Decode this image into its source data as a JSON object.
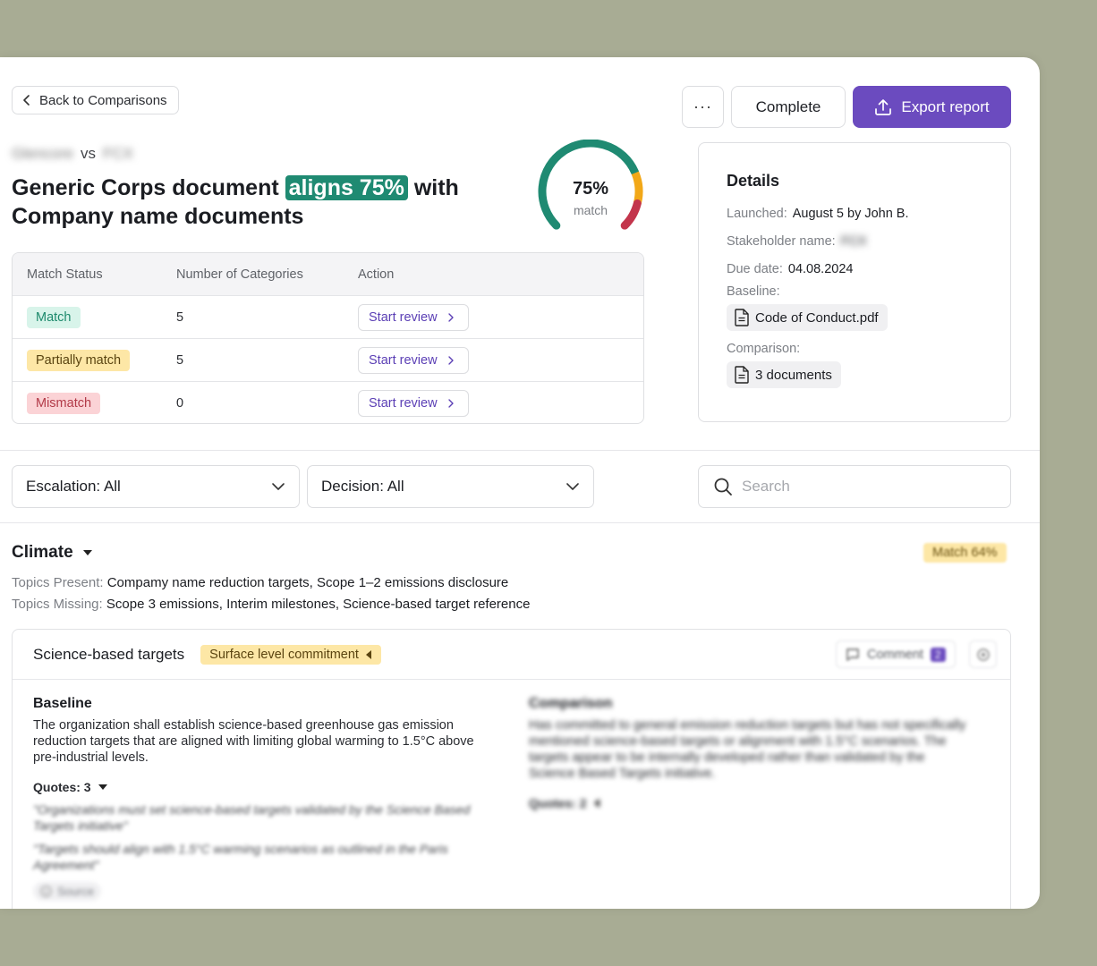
{
  "header": {
    "back_label": "Back to Comparisons",
    "more_label": "···",
    "complete_label": "Complete",
    "export_label": "Export report"
  },
  "comparison": {
    "left_company": "Glencore",
    "vs": "vs",
    "right_company": "FCX",
    "headline_pre": "Generic Corps document",
    "headline_highlight": "aligns 75%",
    "headline_post": "with Company name documents"
  },
  "gauge": {
    "percent_label": "75%",
    "sub_label": "match",
    "value": 75,
    "colors": {
      "match": "#1f8a72",
      "partial": "#f2a818",
      "mismatch": "#c3354c"
    }
  },
  "status_table": {
    "headers": [
      "Match Status",
      "Number of Categories",
      "Action"
    ],
    "rows": [
      {
        "status": "Match",
        "count": "5",
        "action": "Start review"
      },
      {
        "status": "Partially match",
        "count": "5",
        "action": "Start review"
      },
      {
        "status": "Mismatch",
        "count": "0",
        "action": "Start review"
      }
    ]
  },
  "details": {
    "title": "Details",
    "launched_label": "Launched:",
    "launched_value": "August 5 by John B.",
    "stakeholder_label": "Stakeholder name:",
    "stakeholder_value": "FCX",
    "due_label": "Due date:",
    "due_value": "04.08.2024",
    "baseline_label": "Baseline:",
    "baseline_file": "Code of Conduct.pdf",
    "comparison_label": "Comparison:",
    "comparison_files": "3 documents"
  },
  "filters": {
    "escalation": "Escalation: All",
    "decision": "Decision: All",
    "search_placeholder": "Search"
  },
  "section": {
    "title": "Climate",
    "badge": "Match 64%",
    "present_label": "Topics Present:",
    "present_value": "Compamy name reduction targets, Scope 1–2 emissions disclosure",
    "missing_label": "Topics Missing:",
    "missing_value": "Scope 3 emissions, Interim milestones, Science-based target reference"
  },
  "topic_card": {
    "title": "Science-based targets",
    "badge": "Surface level commitment",
    "comment_label": "Comment",
    "comment_count": "2",
    "baseline": {
      "heading": "Baseline",
      "text": "The organization shall establish science-based greenhouse gas emission reduction targets that are aligned with limiting global warming to 1.5°C above pre-industrial levels.",
      "quotes_label": "Quotes: 3",
      "quotes": [
        "\"Organizations must set science-based targets validated by the Science Based Targets initiative\"",
        "\"Targets should align with 1.5°C warming scenarios as outlined in the Paris Agreement\""
      ],
      "source_label": "Source"
    },
    "comparison": {
      "heading": "Comparison",
      "text": "Has committed to general emission reduction targets but has not specifically mentioned science-based targets or alignment with 1.5°C scenarios. The targets appear to be internally developed rather than validated by the Science Based Targets initiative.",
      "quotes_label": "Quotes: 2"
    }
  }
}
